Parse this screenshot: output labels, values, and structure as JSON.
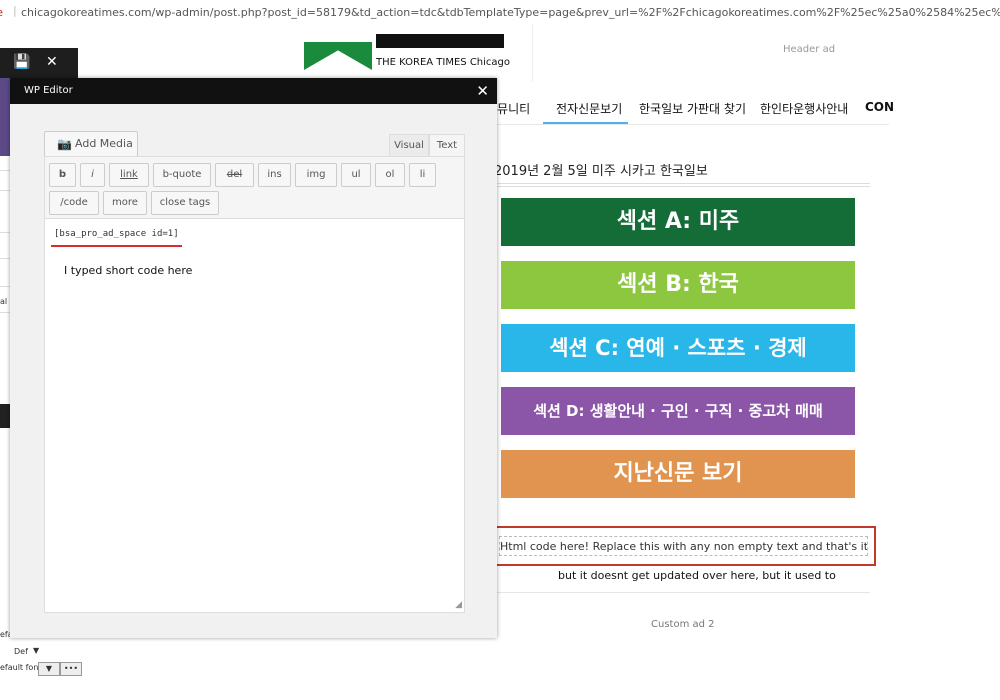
{
  "browser": {
    "insecure_label": "re",
    "url": "chicagokoreatimes.com/wp-admin/post.php?post_id=58179&td_action=tdc&tdbTemplateType=page&prev_url=%2F%2Fchicagokoreatimes.com%2F%25ec%25a0%2584%25ec%259e%25a"
  },
  "site": {
    "logo_text": "THE KOREA TIMES Chicago",
    "header_ad": "Header ad",
    "nav": [
      "커뮤니티",
      "전자신문보기",
      "한국일보 가판대 찾기",
      "한인타운행사안내",
      "CON"
    ],
    "date_title": "2019년 2월 5일 미주 시카고 한국일보",
    "sections": [
      {
        "label": "섹션 A: 미주",
        "color": "#146c37"
      },
      {
        "label": "섹션 B: 한국",
        "color": "#8dc63f"
      },
      {
        "label": "섹션 C: 연예 · 스포츠 · 경제",
        "color": "#29b6e8"
      },
      {
        "label": "섹션 D: 생활안내 · 구인 · 구직 · 중고차 매매",
        "color": "#8b56a8"
      },
      {
        "label": "지난신문 보기",
        "color": "#e0944f"
      }
    ],
    "html_placeholder": "Html code here! Replace this with any non empty text and that's it.",
    "note_below": "but it doesnt get updated over here, but it used to",
    "custom_ad": "Custom ad 2"
  },
  "admin": {
    "label_al": "al",
    "label_efa": "efa",
    "label_def": "Def",
    "label_default_font": "efault font",
    "more_dots": "•••"
  },
  "editor": {
    "title": "WP Editor",
    "add_media": "Add Media",
    "tabs": {
      "visual": "Visual",
      "text": "Text"
    },
    "quicktags_row1": [
      "b",
      "i",
      "link",
      "b-quote",
      "del",
      "ins",
      "img",
      "ul",
      "ol",
      "li"
    ],
    "quicktags_row2": [
      "/code",
      "more",
      "close tags"
    ],
    "shortcode": "[bsa_pro_ad_space id=1]",
    "typed_note": "I typed short code here"
  }
}
